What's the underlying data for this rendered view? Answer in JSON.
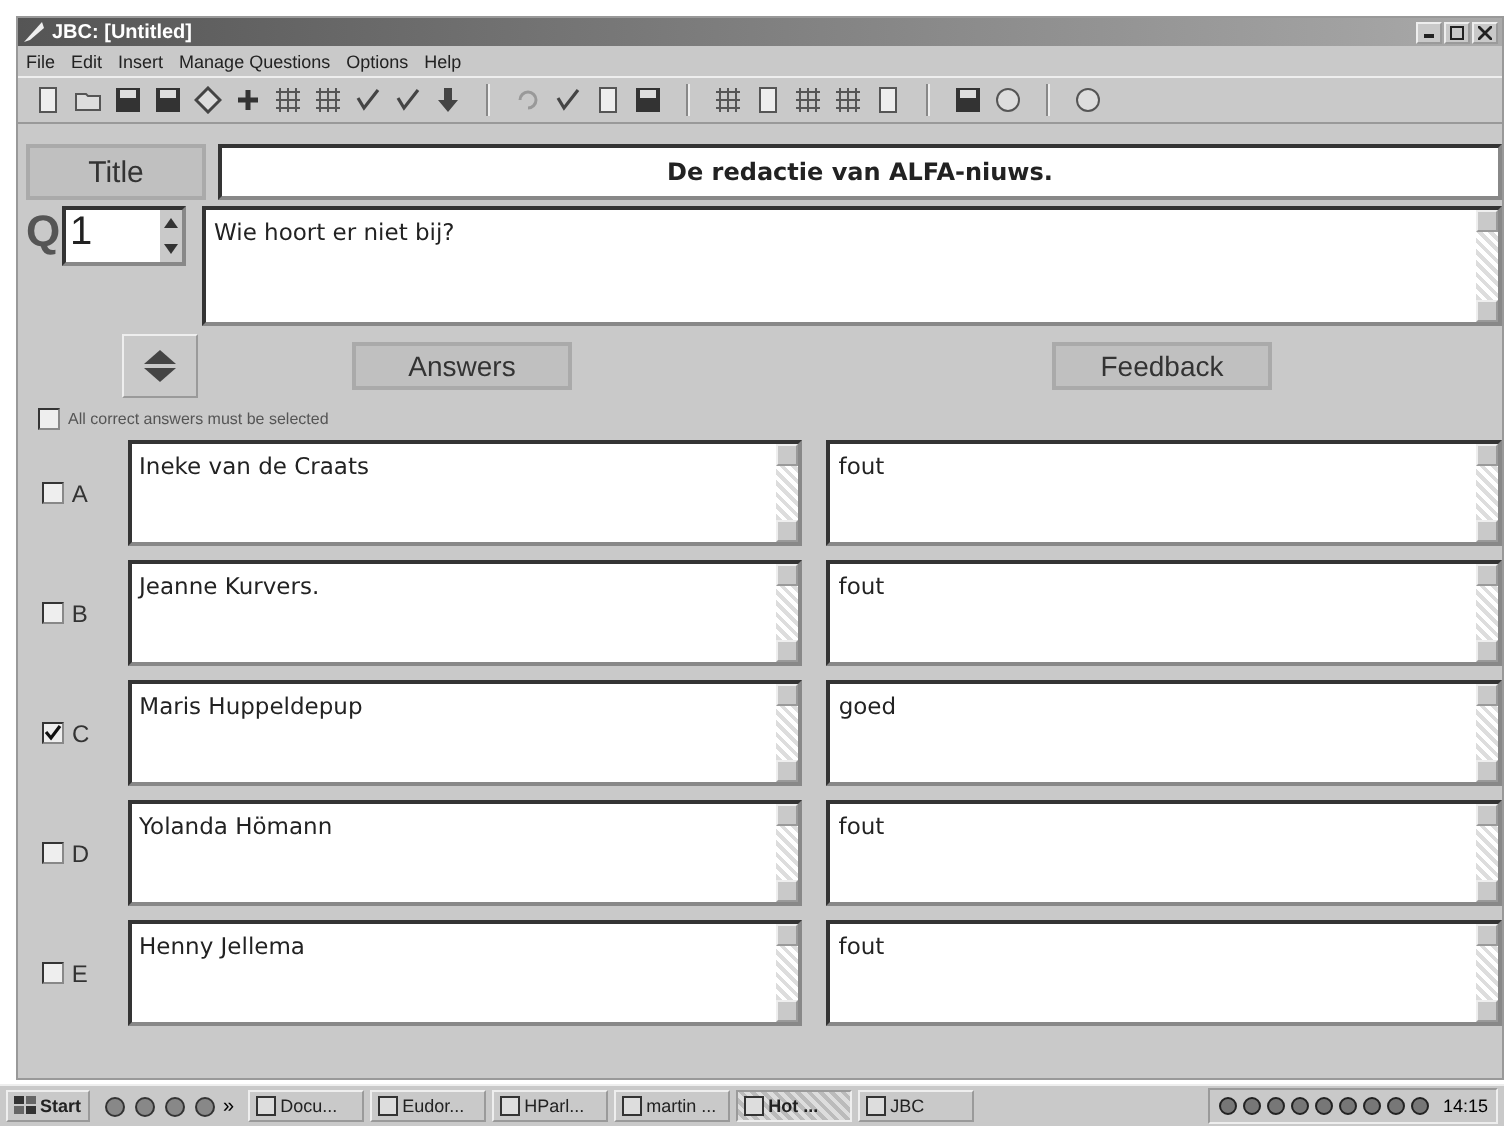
{
  "window": {
    "title": "JBC: [Untitled]"
  },
  "menu": [
    "File",
    "Edit",
    "Insert",
    "Manage Questions",
    "Options",
    "Help"
  ],
  "title": {
    "label": "Title",
    "value": "De redactie van ALFA-niuws."
  },
  "question": {
    "prefix": "Q",
    "number": "1",
    "text": "Wie hoort er niet bij?"
  },
  "headers": {
    "answers": "Answers",
    "feedback": "Feedback"
  },
  "all_correct": {
    "label": "All correct answers must be selected",
    "checked": false
  },
  "answers": [
    {
      "letter": "A",
      "text": "Ineke van de Craats",
      "feedback": "fout",
      "correct": false
    },
    {
      "letter": "B",
      "text": "Jeanne Kurvers.",
      "feedback": "fout",
      "correct": false
    },
    {
      "letter": "C",
      "text": "Maris Huppeldepup",
      "feedback": "goed",
      "correct": true
    },
    {
      "letter": "D",
      "text": "Yolanda Hömann",
      "feedback": "fout",
      "correct": false
    },
    {
      "letter": "E",
      "text": "Henny Jellema",
      "feedback": "fout",
      "correct": false
    }
  ],
  "taskbar": {
    "start": "Start",
    "overflow": "»",
    "buttons": [
      {
        "label": "Docu...",
        "selected": false
      },
      {
        "label": "Eudor...",
        "selected": false
      },
      {
        "label": "HParl...",
        "selected": false
      },
      {
        "label": "martin ...",
        "selected": false
      },
      {
        "label": "Hot ...",
        "selected": true
      },
      {
        "label": "JBC",
        "selected": false
      }
    ],
    "clock": "14:15"
  }
}
